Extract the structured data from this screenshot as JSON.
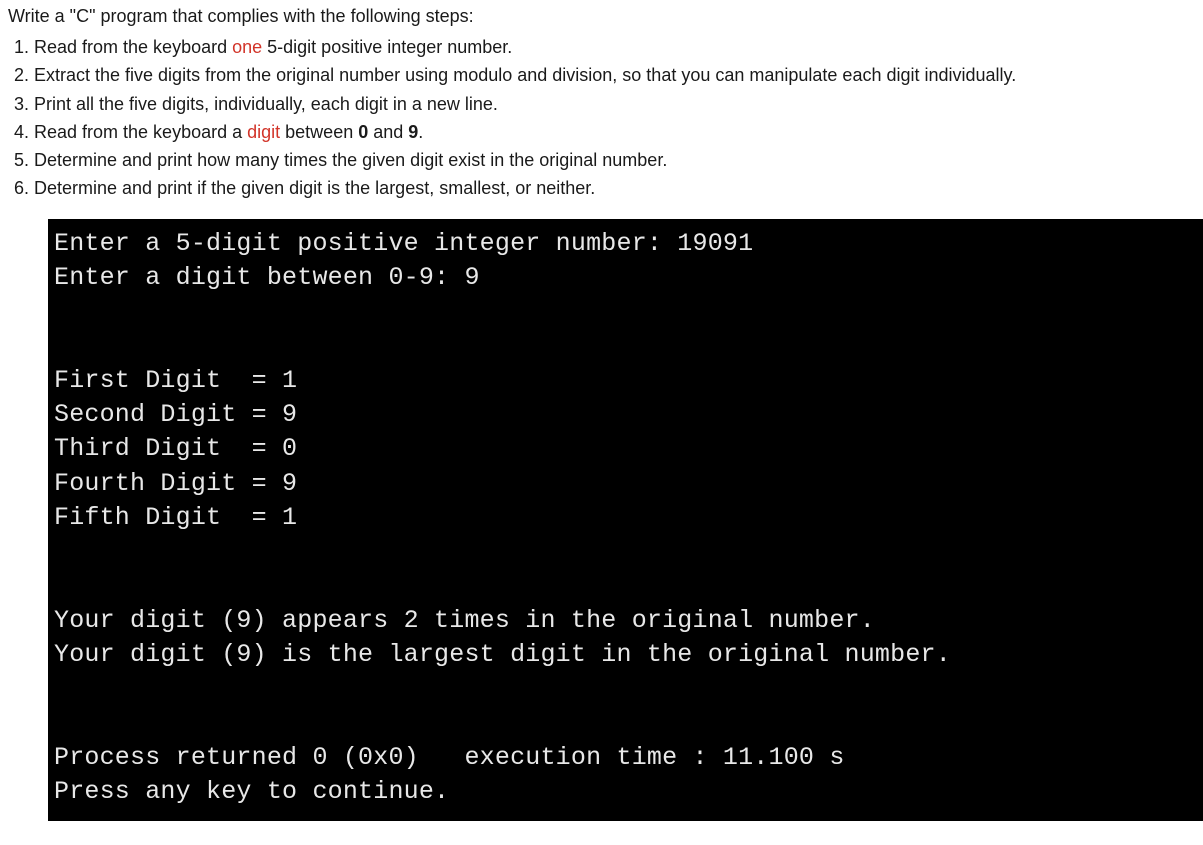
{
  "prompt": "Write a \"C\" program that complies with the following steps:",
  "steps": [
    {
      "pre": "Read from the keyboard ",
      "hl": "one",
      "post": " 5-digit positive integer number."
    },
    {
      "pre": "Extract the five digits from the original number using modulo and division, so that you can manipulate each digit individually.",
      "hl": "",
      "post": ""
    },
    {
      "pre": "Print all the five digits, individually, each digit in a new line.",
      "hl": "",
      "post": ""
    },
    {
      "pre": "Read from the keyboard a ",
      "hl": "digit",
      "post": " between ",
      "hl2": "0",
      "mid": " and ",
      "hl3": "9",
      "post2": "."
    },
    {
      "pre": "Determine and print how many times the given digit exist in the original number.",
      "hl": "",
      "post": ""
    },
    {
      "pre": "Determine and print if the given digit is the largest, smallest, or neither.",
      "hl": "",
      "post": ""
    }
  ],
  "terminal": {
    "lines": [
      "Enter a 5-digit positive integer number: 19091",
      "Enter a digit between 0-9: 9",
      "",
      "",
      "First Digit  = 1",
      "Second Digit = 9",
      "Third Digit  = 0",
      "Fourth Digit = 9",
      "Fifth Digit  = 1",
      "",
      "",
      "Your digit (9) appears 2 times in the original number.",
      "Your digit (9) is the largest digit in the original number.",
      "",
      "",
      "Process returned 0 (0x0)   execution time : 11.100 s",
      "Press any key to continue."
    ]
  }
}
